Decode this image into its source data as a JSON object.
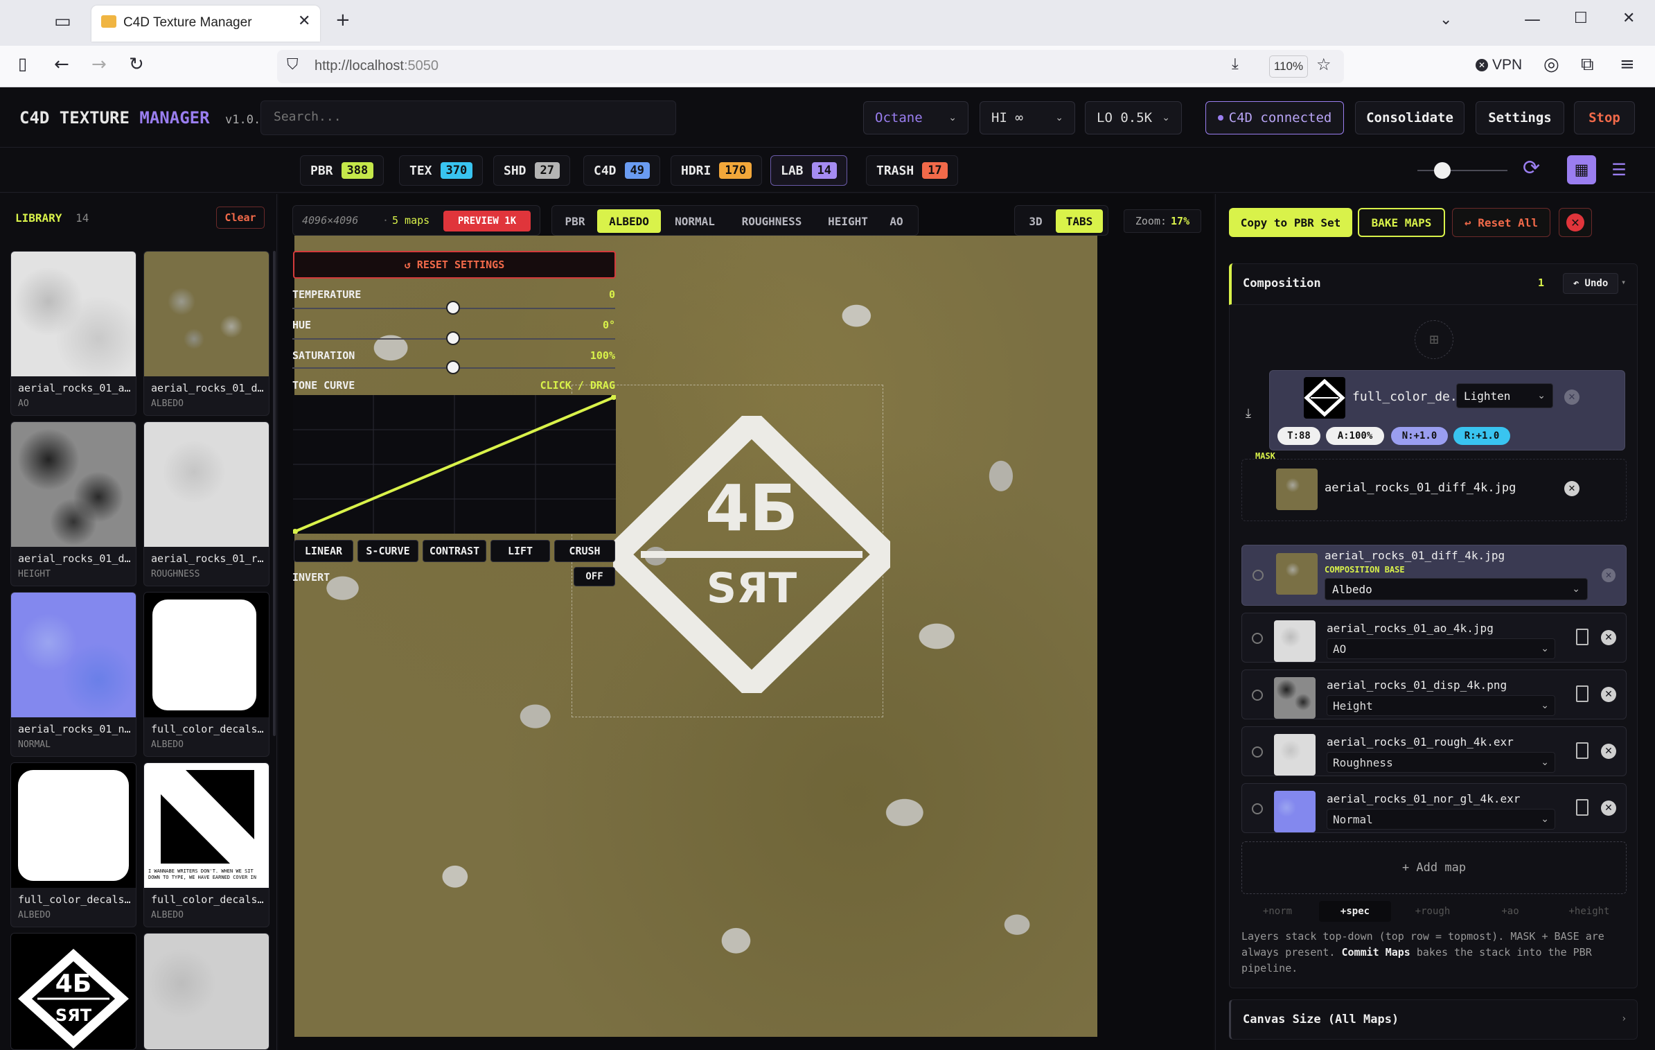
{
  "browser": {
    "tab_title": "C4D Texture Manager",
    "url_host": "http://localhost",
    "url_port": ":5050",
    "zoom": "110%",
    "vpn": "VPN"
  },
  "header": {
    "title_a": "C4D TEXTURE",
    "title_b": "MANAGER",
    "version": "v1.0.0",
    "search_placeholder": "Search...",
    "renderer": "Octane",
    "hi": "HI ∞",
    "lo": "LO 0.5K",
    "c4d_status": "C4D connected",
    "consolidate": "Consolidate",
    "settings": "Settings",
    "stop": "Stop"
  },
  "categories": [
    {
      "label": "PBR",
      "count": "388",
      "color": "#c5e84a"
    },
    {
      "label": "TEX",
      "count": "370",
      "color": "#39c4f0"
    },
    {
      "label": "SHD",
      "count": "27",
      "color": "#b4b4b4"
    },
    {
      "label": "C4D",
      "count": "49",
      "color": "#6a9cf2"
    },
    {
      "label": "HDRI",
      "count": "170",
      "color": "#f2a73a"
    },
    {
      "label": "LAB",
      "count": "14",
      "color": "#a58cf2"
    },
    {
      "label": "TRASH",
      "count": "17",
      "color": "#f26a4a"
    }
  ],
  "library": {
    "title": "LIBRARY",
    "count": "14",
    "clear": "Clear",
    "items": [
      {
        "name": "aerial_rocks_01_a...",
        "type": "AO"
      },
      {
        "name": "aerial_rocks_01_d...",
        "type": "ALBEDO"
      },
      {
        "name": "aerial_rocks_01_d...",
        "type": "HEIGHT"
      },
      {
        "name": "aerial_rocks_01_r...",
        "type": "ROUGHNESS"
      },
      {
        "name": "aerial_rocks_01_n...",
        "type": "NORMAL"
      },
      {
        "name": "full_color_decals...",
        "type": "ALBEDO"
      },
      {
        "name": "full_color_decals...",
        "type": "ALBEDO"
      },
      {
        "name": "full_color_decals...",
        "type": "ALBEDO"
      }
    ],
    "thumb_text": "I WANNABE WRITERS DON'T. WHEN WE SIT DOWN TO TYPE, WE HAVE EARNED COVER IN NEW WAYS",
    "logo_top": "4Б",
    "logo_bottom": "SЯT"
  },
  "toolbar": {
    "resolution": "4096×4096",
    "maps": "5 maps",
    "preview": "PREVIEW 1K",
    "channels": [
      "PBR",
      "ALBEDO",
      "NORMAL",
      "ROUGHNESS",
      "HEIGHT",
      "AO"
    ],
    "view_3d": "3D",
    "view_tabs": "TABS",
    "zoom_label": "Zoom:",
    "zoom_value": "17%"
  },
  "adjust": {
    "reset": "↺ RESET SETTINGS",
    "temperature": "TEMPERATURE",
    "temperature_val": "0",
    "hue": "HUE",
    "hue_val": "0°",
    "saturation": "SATURATION",
    "saturation_val": "100%",
    "tone_curve": "TONE CURVE",
    "tone_hint": "CLICK / DRAG",
    "presets": [
      "LINEAR",
      "S-CURVE",
      "CONTRAST",
      "LIFT",
      "CRUSH"
    ],
    "invert": "INVERT",
    "invert_val": "OFF"
  },
  "right": {
    "copy_pbr": "Copy to PBR Set",
    "bake": "BAKE MAPS",
    "reset_all": "↩ Reset All",
    "composition": "Composition",
    "comp_count": "1",
    "undo": "↶ Undo",
    "decal_layer": {
      "name": "full_color_de...",
      "blend": "Lighten",
      "pills": [
        "T:88",
        "A:100%",
        "N:+1.0",
        "R:+1.0"
      ]
    },
    "mask_label": "MASK",
    "mask_name": "aerial_rocks_01_diff_4k.jpg",
    "base": {
      "name": "aerial_rocks_01_diff_4k.jpg",
      "tag": "COMPOSITION BASE",
      "type": "Albedo"
    },
    "maps": [
      {
        "name": "aerial_rocks_01_ao_4k.jpg",
        "type": "AO"
      },
      {
        "name": "aerial_rocks_01_disp_4k.png",
        "type": "Height"
      },
      {
        "name": "aerial_rocks_01_rough_4k.exr",
        "type": "Roughness"
      },
      {
        "name": "aerial_rocks_01_nor_gl_4k.exr",
        "type": "Normal"
      }
    ],
    "add_map": "+ Add map",
    "chips": [
      "+norm",
      "+spec",
      "+rough",
      "+ao",
      "+height"
    ],
    "help_1": "Layers stack top-down (top row = topmost). MASK + BASE are",
    "help_2": "always present.",
    "help_bold": "Commit Maps",
    "help_3": "bakes the stack into the PBR",
    "help_4": "pipeline.",
    "canvas_size": "Canvas Size (All Maps)"
  },
  "colors": {
    "accent": "#d9f24a",
    "purple": "#9a7ef0",
    "danger": "#e0353b"
  }
}
